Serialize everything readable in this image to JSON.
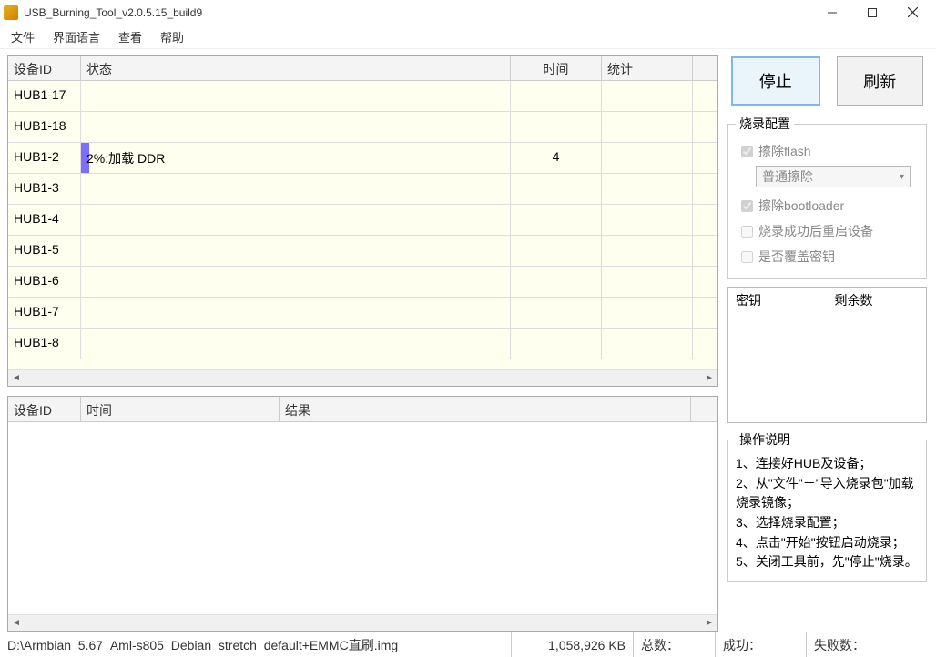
{
  "window": {
    "title": "USB_Burning_Tool_v2.0.5.15_build9"
  },
  "menu": {
    "file": "文件",
    "lang": "界面语言",
    "view": "查看",
    "help": "帮助"
  },
  "grid1": {
    "headers": {
      "device": "设备ID",
      "status": "状态",
      "time": "时间",
      "stats": "统计"
    },
    "rows": [
      {
        "device": "HUB1-17",
        "status": "",
        "time": "",
        "stats": "",
        "pct": 0
      },
      {
        "device": "HUB1-18",
        "status": "",
        "time": "",
        "stats": "",
        "pct": 0
      },
      {
        "device": "HUB1-2",
        "status": "2%:加载 DDR",
        "time": "4",
        "stats": "",
        "pct": 2
      },
      {
        "device": "HUB1-3",
        "status": "",
        "time": "",
        "stats": "",
        "pct": 0
      },
      {
        "device": "HUB1-4",
        "status": "",
        "time": "",
        "stats": "",
        "pct": 0
      },
      {
        "device": "HUB1-5",
        "status": "",
        "time": "",
        "stats": "",
        "pct": 0
      },
      {
        "device": "HUB1-6",
        "status": "",
        "time": "",
        "stats": "",
        "pct": 0
      },
      {
        "device": "HUB1-7",
        "status": "",
        "time": "",
        "stats": "",
        "pct": 0
      },
      {
        "device": "HUB1-8",
        "status": "",
        "time": "",
        "stats": "",
        "pct": 0
      }
    ]
  },
  "grid2": {
    "headers": {
      "device": "设备ID",
      "time": "时间",
      "result": "结果"
    }
  },
  "buttons": {
    "stop": "停止",
    "refresh": "刷新"
  },
  "burn_cfg": {
    "legend": "烧录配置",
    "erase_flash": "擦除flash",
    "erase_mode": "普通擦除",
    "erase_bootloader": "擦除bootloader",
    "reboot_after": "烧录成功后重启设备",
    "overwrite_key": "是否覆盖密钥"
  },
  "keys": {
    "h1": "密钥",
    "h2": "剩余数"
  },
  "instructions": {
    "legend": "操作说明",
    "l1": "1、连接好HUB及设备；",
    "l2": "2、从\"文件\"－\"导入烧录包\"加载烧录镜像；",
    "l3": "3、选择烧录配置；",
    "l4": "4、点击\"开始\"按钮启动烧录；",
    "l5": "5、关闭工具前，先\"停止\"烧录。"
  },
  "status": {
    "path": "D:\\Armbian_5.67_Aml-s805_Debian_stretch_default+EMMC直刷.img",
    "size": "1,058,926 KB",
    "total_label": "总数：",
    "succ_label": "成功：",
    "fail_label": "失败数："
  }
}
